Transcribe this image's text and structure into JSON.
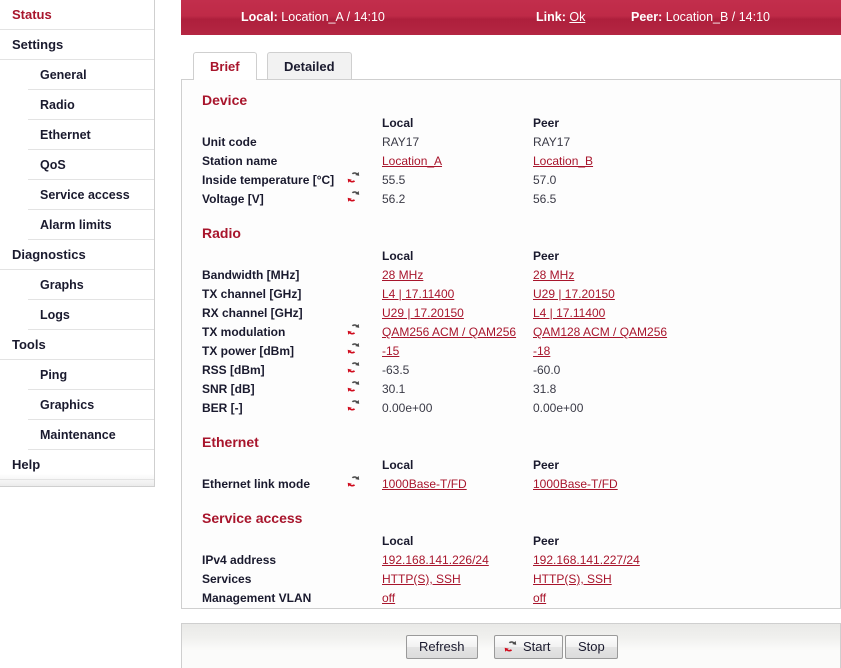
{
  "sidebar": {
    "items": [
      {
        "label": "Status",
        "level": 1,
        "active": true
      },
      {
        "label": "Settings",
        "level": 1,
        "active": false
      },
      {
        "label": "General",
        "level": 2,
        "active": false
      },
      {
        "label": "Radio",
        "level": 2,
        "active": false
      },
      {
        "label": "Ethernet",
        "level": 2,
        "active": false
      },
      {
        "label": "QoS",
        "level": 2,
        "active": false
      },
      {
        "label": "Service access",
        "level": 2,
        "active": false
      },
      {
        "label": "Alarm limits",
        "level": 2,
        "active": false
      },
      {
        "label": "Diagnostics",
        "level": 1,
        "active": false
      },
      {
        "label": "Graphs",
        "level": 2,
        "active": false
      },
      {
        "label": "Logs",
        "level": 2,
        "active": false
      },
      {
        "label": "Tools",
        "level": 1,
        "active": false
      },
      {
        "label": "Ping",
        "level": 2,
        "active": false
      },
      {
        "label": "Graphics",
        "level": 2,
        "active": false
      },
      {
        "label": "Maintenance",
        "level": 2,
        "active": false
      },
      {
        "label": "Help",
        "level": 1,
        "active": false
      }
    ]
  },
  "topbar": {
    "local_label": "Local:",
    "local_value": "Location_A / 14:10",
    "link_label": "Link:",
    "link_value": "Ok",
    "peer_label": "Peer:",
    "peer_value": "Location_B / 14:10"
  },
  "tabs": [
    {
      "label": "Brief",
      "active": true
    },
    {
      "label": "Detailed",
      "active": false
    }
  ],
  "column_headers": {
    "local": "Local",
    "peer": "Peer"
  },
  "sections": [
    {
      "title": "Device",
      "rows": [
        {
          "label": "Unit code",
          "icon": false,
          "local": "RAY17",
          "peer": "RAY17",
          "link": false
        },
        {
          "label": "Station name",
          "icon": false,
          "local": "Location_A",
          "peer": "Location_B",
          "link": true
        },
        {
          "label": "Inside temperature [°C]",
          "icon": true,
          "local": "55.5",
          "peer": "57.0",
          "link": false
        },
        {
          "label": "Voltage [V]",
          "icon": true,
          "local": "56.2",
          "peer": "56.5",
          "link": false
        }
      ]
    },
    {
      "title": "Radio",
      "rows": [
        {
          "label": "Bandwidth [MHz]",
          "icon": false,
          "local": "28 MHz",
          "peer": "28 MHz",
          "link": true
        },
        {
          "label": "TX channel [GHz]",
          "icon": false,
          "local": "L4 | 17.11400",
          "peer": "U29 | 17.20150",
          "link": true
        },
        {
          "label": "RX channel [GHz]",
          "icon": false,
          "local": "U29 | 17.20150",
          "peer": "L4 | 17.11400",
          "link": true
        },
        {
          "label": "TX modulation",
          "icon": true,
          "local": "QAM256 ACM / QAM256",
          "peer": "QAM128 ACM / QAM256",
          "link": true
        },
        {
          "label": "TX power [dBm]",
          "icon": true,
          "local": "-15",
          "peer": "-18",
          "link": true
        },
        {
          "label": "RSS [dBm]",
          "icon": true,
          "local": "-63.5",
          "peer": "-60.0",
          "link": false
        },
        {
          "label": "SNR [dB]",
          "icon": true,
          "local": "30.1",
          "peer": "31.8",
          "link": false
        },
        {
          "label": "BER [-]",
          "icon": true,
          "local": "0.00e+00",
          "peer": "0.00e+00",
          "link": false
        }
      ]
    },
    {
      "title": "Ethernet",
      "rows": [
        {
          "label": "Ethernet link mode",
          "icon": true,
          "local": "1000Base-T/FD",
          "peer": "1000Base-T/FD",
          "link": true
        }
      ]
    },
    {
      "title": "Service access",
      "rows": [
        {
          "label": "IPv4 address",
          "icon": false,
          "local": "192.168.141.226/24",
          "peer": "192.168.141.227/24",
          "link": true
        },
        {
          "label": "Services",
          "icon": false,
          "local": "HTTP(S), SSH",
          "peer": "HTTP(S), SSH",
          "link": true
        },
        {
          "label": "Management VLAN",
          "icon": false,
          "local": "off",
          "peer": "off",
          "link": true
        }
      ]
    }
  ],
  "buttons": {
    "refresh": "Refresh",
    "start": "Start",
    "stop": "Stop"
  },
  "icons": {
    "refresh": "refresh-icon"
  },
  "colors": {
    "accent": "#a8152c",
    "header_bar": "#bf2a47",
    "link": "#a8152c",
    "panel_border": "#cfcfcf"
  }
}
